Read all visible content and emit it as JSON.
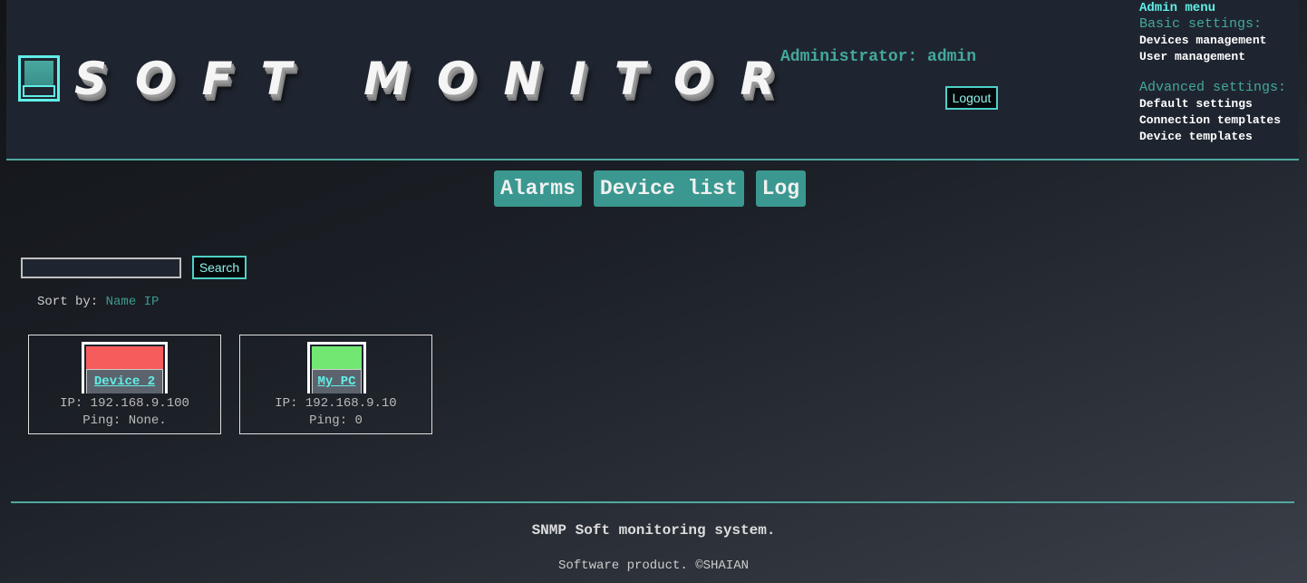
{
  "header": {
    "logo_text": "SOFT MONITOR",
    "admin_label": "Administrator: admin",
    "logout_label": "Logout"
  },
  "admin_menu": {
    "title": "Admin menu",
    "basic_title": "Basic settings:",
    "basic_items": [
      "Devices management",
      "User management"
    ],
    "advanced_title": "Advanced settings:",
    "advanced_items": [
      "Default settings",
      "Connection templates",
      "Device templates"
    ]
  },
  "nav": [
    "Alarms",
    "Device list",
    "Log"
  ],
  "search": {
    "value": "",
    "button": "Search"
  },
  "sort": {
    "label": "Sort by:",
    "options": [
      "Name",
      "IP"
    ]
  },
  "devices": [
    {
      "name": "Device 2",
      "ip": "IP: 192.168.9.100",
      "ping": "Ping: None.",
      "status_color": "#f75c5c"
    },
    {
      "name": "My PC",
      "ip": "IP: 192.168.9.10",
      "ping": "Ping: 0",
      "status_color": "#72e872"
    }
  ],
  "footer": {
    "title": "SNMP Soft monitoring system.",
    "copyright": "Software product. ©SHAIAN"
  }
}
